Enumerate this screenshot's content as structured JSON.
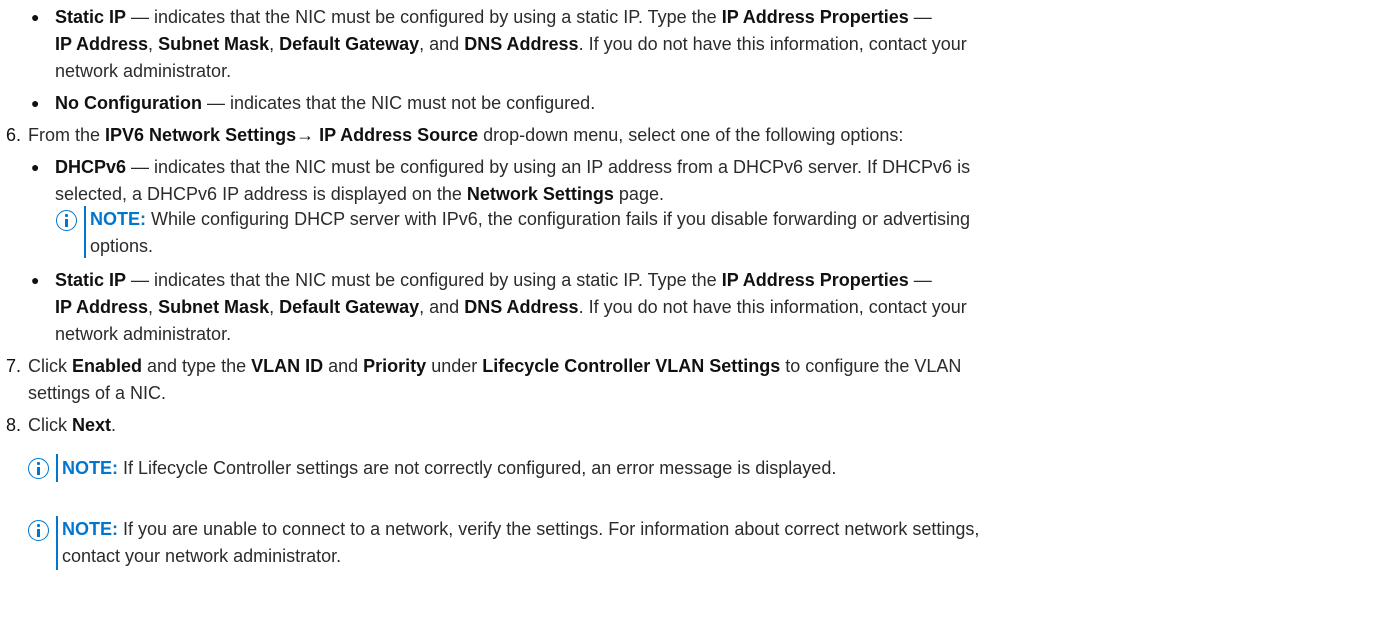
{
  "list": {
    "bullet_glyph": "●",
    "step6_num": "6.",
    "step7_num": "7.",
    "step8_num": "8."
  },
  "b1": {
    "term": "Static IP",
    "t1": " — indicates that the NIC must be configured by using a static IP. Type the ",
    "props": "IP Address Properties",
    "t2": " —",
    "ip": "IP Address",
    "c1": ", ",
    "mask": "Subnet Mask",
    "c2": ", ",
    "gw": "Default Gateway",
    "c3": ", and ",
    "dns": "DNS Address",
    "t3": ". If you do not have this information, contact your",
    "t4": "network administrator."
  },
  "b2": {
    "term": "No Configuration",
    "t1": " — indicates that the NIC must not be configured."
  },
  "s6": {
    "t1": "From the ",
    "menu": "IPV6 Network Settings→ IP Address Source",
    "t2": " drop-down menu, select one of the following options:"
  },
  "b3": {
    "term": "DHCPv6",
    "t1": " — indicates that the NIC must be configured by using an IP address from a DHCPv6 server. If DHCPv6 is",
    "t2": "selected, a DHCPv6 IP address is displayed on the ",
    "page": "Network Settings",
    "t3": " page."
  },
  "note1": {
    "label": "NOTE:",
    "t1": " While configuring DHCP server with IPv6, the configuration fails if you disable forwarding or advertising",
    "t2": "options."
  },
  "b4": {
    "term": "Static IP",
    "t1": " — indicates that the NIC must be configured by using a static IP. Type the ",
    "props": "IP Address Properties",
    "t2": " —",
    "ip": "IP Address",
    "c1": ", ",
    "mask": "Subnet Mask",
    "c2": ", ",
    "gw": "Default Gateway",
    "c3": ", and ",
    "dns": "DNS Address",
    "t3": ". If you do not have this information, contact your",
    "t4": "network administrator."
  },
  "s7": {
    "t1": "Click ",
    "enabled": "Enabled",
    "t2": " and type the ",
    "vlan": "VLAN ID",
    "t3": " and ",
    "priority": "Priority",
    "t4": " under ",
    "settings": "Lifecycle Controller VLAN Settings",
    "t5": " to configure the VLAN",
    "t6": "settings of a NIC."
  },
  "s8": {
    "t1": "Click ",
    "next": "Next",
    "t2": "."
  },
  "note2": {
    "label": "NOTE:",
    "t1": " If Lifecycle Controller settings are not correctly configured, an error message is displayed."
  },
  "note3": {
    "label": "NOTE:",
    "t1": " If you are unable to connect to a network, verify the settings. For information about correct network settings,",
    "t2": "contact your network administrator."
  }
}
